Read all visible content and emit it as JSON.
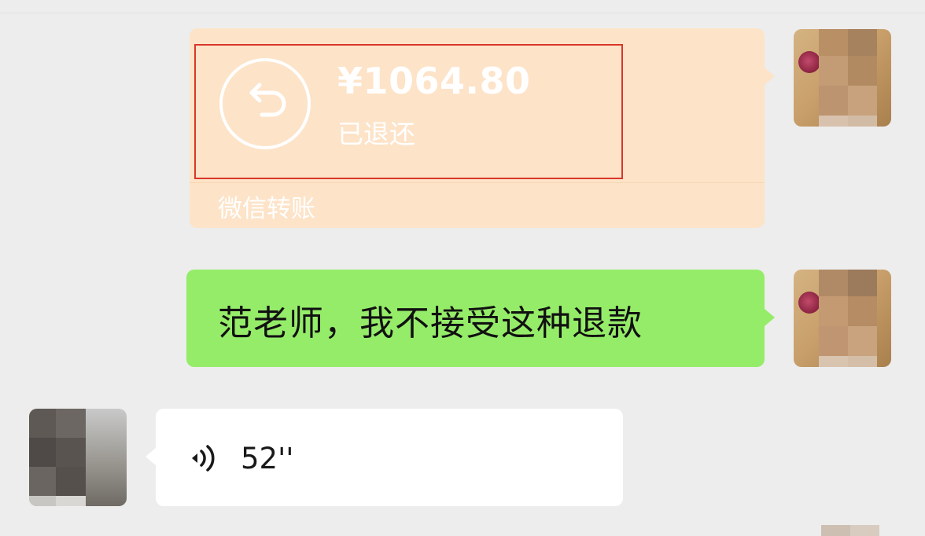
{
  "messages": [
    {
      "type": "transfer",
      "sender": "me",
      "amount": "¥1064.80",
      "status": "已退还",
      "label": "微信转账",
      "icon": "return-arrow-icon",
      "bubble_color": "#fde3c8"
    },
    {
      "type": "text",
      "sender": "me",
      "text": "范老师，我不接受这种退款",
      "bubble_color": "#95ec69"
    },
    {
      "type": "voice",
      "sender": "other",
      "duration": "52''",
      "icon": "voice-wave-icon",
      "bubble_color": "#ffffff"
    }
  ],
  "colors": {
    "background": "#ededed",
    "highlight_border": "#d9372a"
  }
}
